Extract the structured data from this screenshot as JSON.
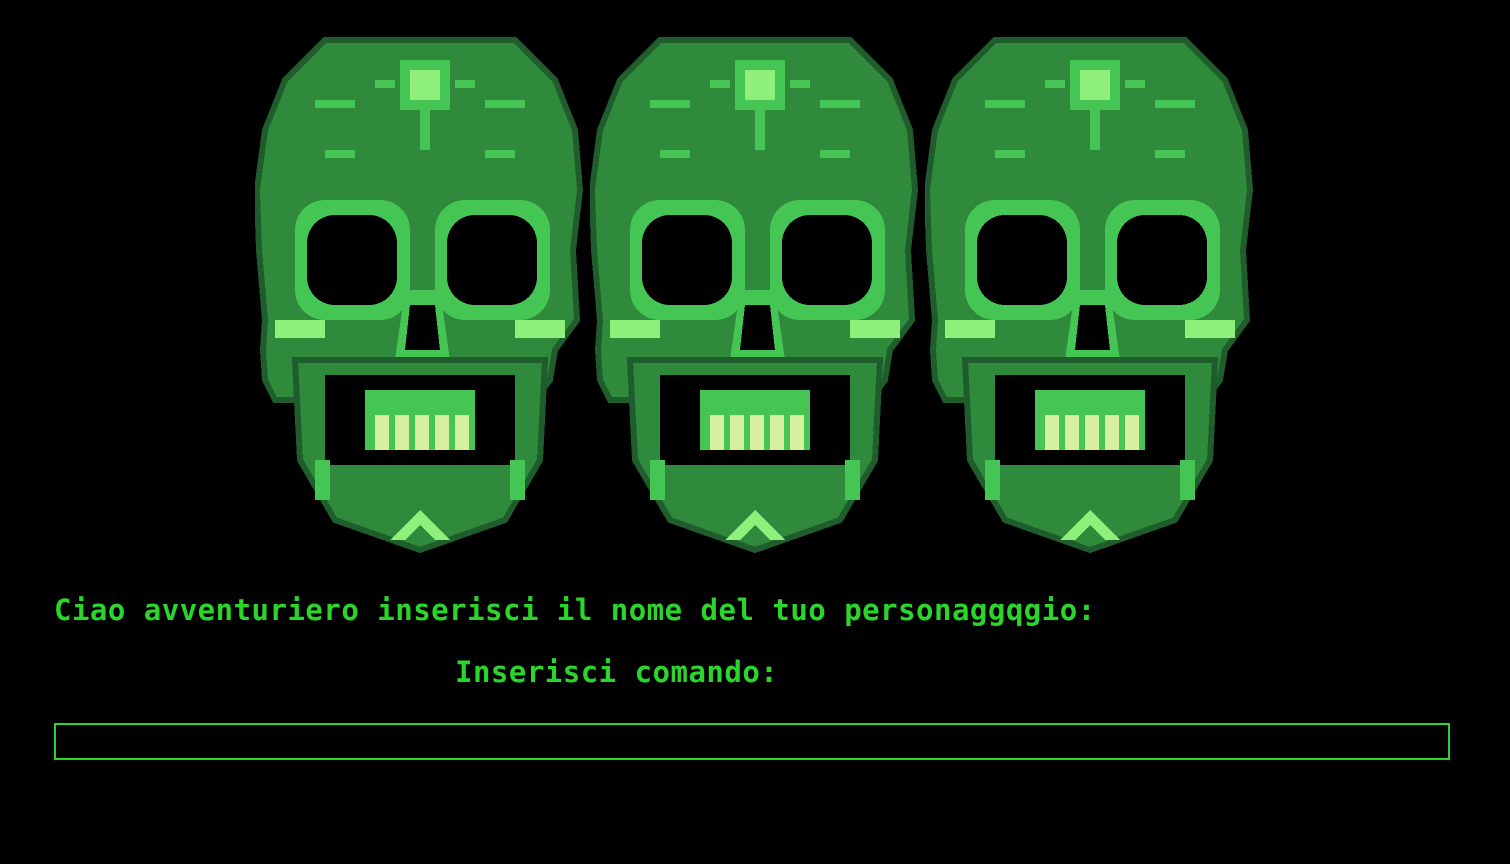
{
  "colors": {
    "background": "#000000",
    "text": "#2bd62b",
    "input_border": "#2bd62b",
    "skull_dark": "#1f5e2c",
    "skull_mid": "#2f8a3c",
    "skull_light": "#45c553",
    "skull_bright": "#8ef07a",
    "teeth": "#d6f0a0"
  },
  "banner": {
    "image": "three-green-pixel-skulls",
    "skull_count": 3
  },
  "prompt": {
    "text": "Ciao avventuriero inserisci il nome del tuo personaggqgio:"
  },
  "command": {
    "label": "Inserisci comando:",
    "value": "",
    "placeholder": ""
  }
}
